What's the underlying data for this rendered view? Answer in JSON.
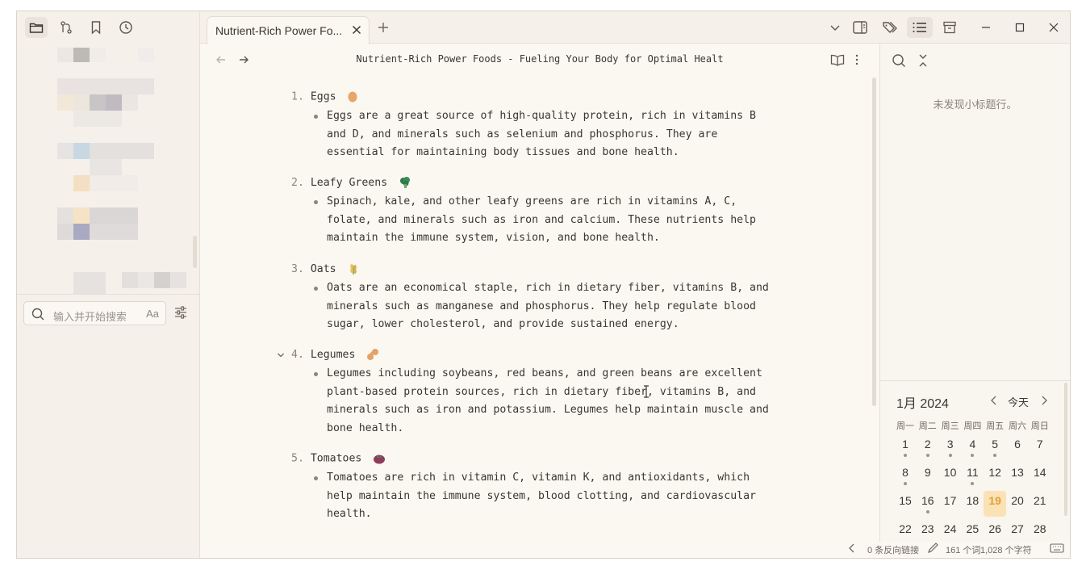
{
  "tab": {
    "title": "Nutrient-Rich Power Fo..."
  },
  "document": {
    "title": "Nutrient-Rich Power Foods - Fueling Your Body for Optimal Healt"
  },
  "sidebar": {
    "search_placeholder": "输入并开始搜索",
    "case_toggle": "Aa"
  },
  "outline": {
    "empty_text": "未发现小标题行。"
  },
  "items": [
    {
      "num": "1.",
      "name": "Eggs",
      "emoji": "egg-icon",
      "lines": [
        "Eggs are a great source of high-quality protein, rich in vitamins B",
        "and D, and minerals such as selenium and phosphorus. They are",
        "essential for maintaining body tissues and bone health."
      ]
    },
    {
      "num": "2.",
      "name": "Leafy Greens",
      "emoji": "broccoli-icon",
      "lines": [
        "Spinach, kale, and other leafy greens are rich in vitamins A, C,",
        "folate, and minerals such as iron and calcium. These nutrients help",
        "maintain the immune system, vision, and bone health."
      ]
    },
    {
      "num": "3.",
      "name": "Oats",
      "emoji": "oats-icon",
      "lines": [
        "Oats are an economical staple, rich in dietary fiber, vitamins B, and",
        "minerals such as manganese and phosphorus. They help regulate blood",
        "sugar, lower cholesterol, and provide sustained energy."
      ]
    },
    {
      "num": "4.",
      "name": "Legumes",
      "emoji": "peanut-icon",
      "lines": [
        "Legumes including soybeans, red beans, and green beans are excellent",
        "plant-based protein sources, rich in dietary fiber, vitamins B, and",
        "minerals such as iron and potassium. Legumes help maintain muscle and",
        "bone health."
      ]
    },
    {
      "num": "5.",
      "name": "Tomatoes",
      "emoji": "tomato-icon",
      "lines": [
        "Tomatoes are rich in vitamin C, vitamin K, and antioxidants, which",
        "help maintain the immune system, blood clotting, and cardiovascular",
        "health."
      ]
    }
  ],
  "calendar": {
    "month_label": "1月 2024",
    "today_label": "今天",
    "weekdays": [
      "周一",
      "周二",
      "周三",
      "周四",
      "周五",
      "周六",
      "周日"
    ],
    "weeks": [
      [
        "1",
        "2",
        "3",
        "4",
        "5",
        "6",
        "7"
      ],
      [
        "8",
        "9",
        "10",
        "11",
        "12",
        "13",
        "14"
      ],
      [
        "15",
        "16",
        "17",
        "18",
        "19",
        "20",
        "21"
      ],
      [
        "22",
        "23",
        "24",
        "25",
        "26",
        "27",
        "28"
      ]
    ],
    "dotted_days": [
      "1",
      "2",
      "3",
      "4",
      "5",
      "8",
      "11",
      "16"
    ],
    "today_day": "19",
    "today_color": "#fbe2b5"
  },
  "status": {
    "backlinks": "0 条反向链接",
    "words": "161 个词",
    "chars": "1,028 个字符"
  }
}
